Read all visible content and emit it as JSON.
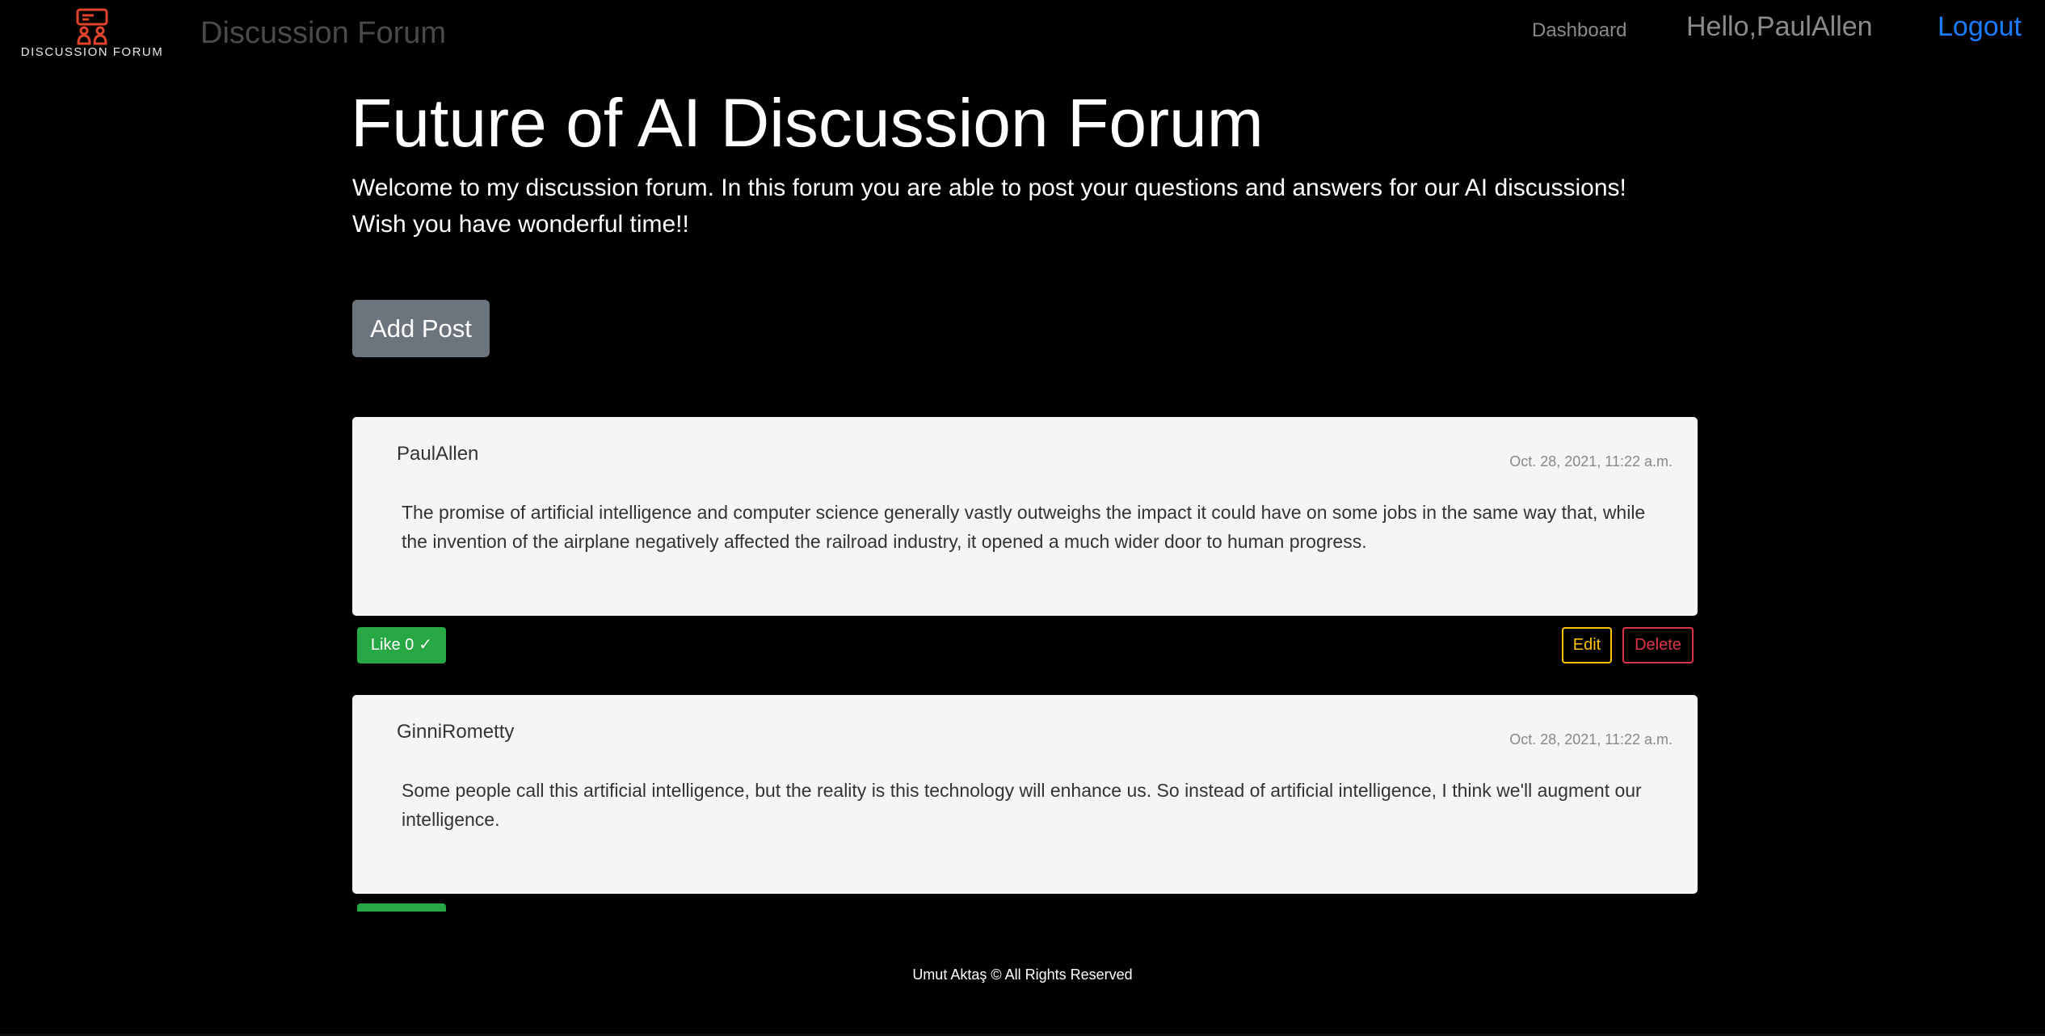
{
  "navbar": {
    "logo_text": "DISCUSSION FORUM",
    "brand": "Discussion Forum",
    "dashboard_label": "Dashboard",
    "greeting": "Hello,PaulAllen",
    "logout_label": "Logout"
  },
  "header": {
    "title": "Future of AI Discussion Forum",
    "lead_line1": "Welcome to my discussion forum. In this forum you are able to post your questions and answers for our AI discussions!",
    "lead_line2": "Wish you have wonderful time!!"
  },
  "add_post_label": "Add Post",
  "posts": [
    {
      "author": "PaulAllen",
      "date": "Oct. 28, 2021, 11:22 a.m.",
      "body": "The promise of artificial intelligence and computer science generally vastly outweighs the impact it could have on some jobs in the same way that, while the invention of the airplane negatively affected the railroad industry, it opened a much wider door to human progress.",
      "like_label": "Like 0",
      "edit_label": "Edit",
      "delete_label": "Delete"
    },
    {
      "author": "GinniRometty",
      "date": "Oct. 28, 2021, 11:22 a.m.",
      "body": "Some people call this artificial intelligence, but the reality is this technology will enhance us. So instead of artificial intelligence, I think we'll augment our intelligence."
    }
  ],
  "footer": "Umut Aktaş © All Rights Reserved",
  "colors": {
    "background": "#000000",
    "logout": "#1a7cff",
    "add_post": "#6c757d",
    "like": "#28a745",
    "edit": "#ffc107",
    "delete": "#dc3545",
    "card": "#f5f5f5",
    "logo": "#e0452b"
  },
  "icons": [
    "logo-icon",
    "check-icon"
  ]
}
